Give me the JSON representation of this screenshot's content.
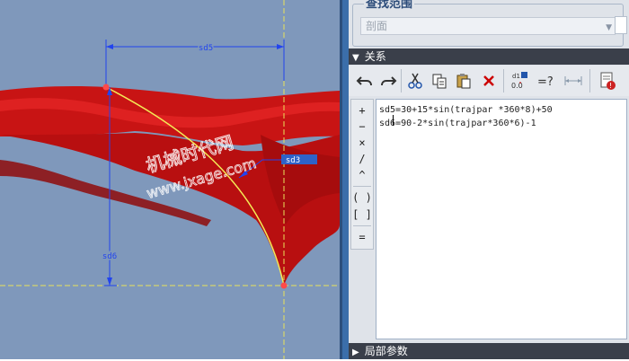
{
  "viewport": {
    "watermark_title": "机械时代网",
    "watermark_url": "www.jxage.com",
    "dimensions": [
      {
        "name": "sd5"
      },
      {
        "name": "sd3"
      },
      {
        "name": "sd6"
      }
    ],
    "colors": {
      "background": "#7f98bb",
      "surface": "#c81414",
      "dimension": "#2244ee",
      "trajectory": "#f4ea56",
      "centerline": "#e8e25a",
      "point": "#ff4a4a"
    }
  },
  "panel": {
    "find_scope_title": "查找范围",
    "scope_select_value": "剖面",
    "relations_title": "关系",
    "local_params_title": "局部参数",
    "toolbar": [
      "undo-icon",
      "redo-icon",
      "cut-icon",
      "copy-icon",
      "paste-icon",
      "delete-icon",
      "switch-dims-icon",
      "evaluate-icon",
      "unit-sensitivity-icon",
      "verify-icon"
    ],
    "operators": {
      "plus": "+",
      "minus": "−",
      "multiply": "×",
      "divide": "/",
      "power": "^",
      "parentheses": "( )",
      "brackets": "[ ]",
      "equals": "="
    },
    "relations": [
      "sd5=30+15*sin(trajpar *360*8)+50",
      "sd6=90-2*sin(trajpar*360*6)-1"
    ]
  }
}
